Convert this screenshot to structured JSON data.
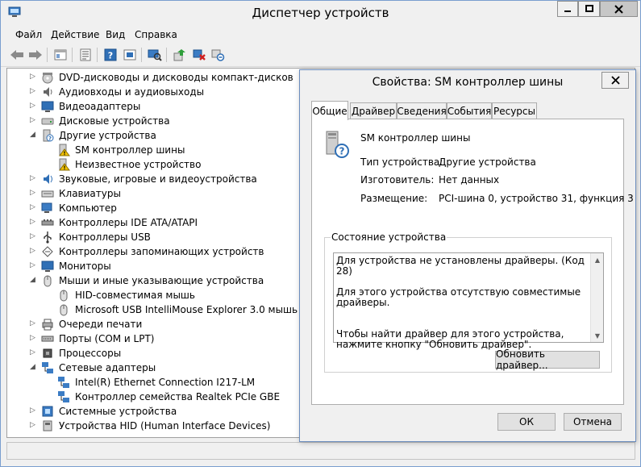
{
  "window": {
    "title": "Диспетчер устройств"
  },
  "menu": [
    "Файл",
    "Действие",
    "Вид",
    "Справка"
  ],
  "toolbar": {
    "buttons": [
      "back-icon",
      "forward-icon",
      "properties-pane-icon",
      "properties-icon",
      "help-icon",
      "refresh-view-icon",
      "scan-hardware-icon",
      "update-driver-icon",
      "uninstall-icon",
      "disable-icon"
    ]
  },
  "tree": {
    "items": [
      {
        "label": "DVD-дисководы и дисководы компакт-дисков",
        "level": 0,
        "expanded": false
      },
      {
        "label": "Аудиовходы и аудиовыходы",
        "level": 0,
        "expanded": false
      },
      {
        "label": "Видеоадаптеры",
        "level": 0,
        "expanded": false
      },
      {
        "label": "Дисковые устройства",
        "level": 0,
        "expanded": false
      },
      {
        "label": "Другие устройства",
        "level": 0,
        "expanded": true
      },
      {
        "label": "SM контроллер шины",
        "level": 1,
        "warning": true
      },
      {
        "label": "Неизвестное устройство",
        "level": 1,
        "warning": true
      },
      {
        "label": "Звуковые, игровые и видеоустройства",
        "level": 0,
        "expanded": false
      },
      {
        "label": "Клавиатуры",
        "level": 0,
        "expanded": false
      },
      {
        "label": "Компьютер",
        "level": 0,
        "expanded": false
      },
      {
        "label": "Контроллеры IDE ATA/ATAPI",
        "level": 0,
        "expanded": false
      },
      {
        "label": "Контроллеры USB",
        "level": 0,
        "expanded": false
      },
      {
        "label": "Контроллеры запоминающих устройств",
        "level": 0,
        "expanded": false
      },
      {
        "label": "Мониторы",
        "level": 0,
        "expanded": false
      },
      {
        "label": "Мыши и иные указывающие устройства",
        "level": 0,
        "expanded": true
      },
      {
        "label": "HID-совместимая мышь",
        "level": 1
      },
      {
        "label": "Microsoft USB IntelliMouse Explorer 3.0 мышь",
        "level": 1
      },
      {
        "label": "Очереди печати",
        "level": 0,
        "expanded": false
      },
      {
        "label": "Порты (COM и LPT)",
        "level": 0,
        "expanded": false
      },
      {
        "label": "Процессоры",
        "level": 0,
        "expanded": false
      },
      {
        "label": "Сетевые адаптеры",
        "level": 0,
        "expanded": true
      },
      {
        "label": "Intel(R) Ethernet Connection I217-LM",
        "level": 1
      },
      {
        "label": "Контроллер семейства Realtek PCIe GBE",
        "level": 1
      },
      {
        "label": "Системные устройства",
        "level": 0,
        "expanded": false
      },
      {
        "label": "Устройства HID (Human Interface Devices)",
        "level": 0,
        "expanded": false
      }
    ]
  },
  "dialog": {
    "title": "Свойства: SM контроллер шины",
    "tabs": [
      "Общие",
      "Драйвер",
      "Сведения",
      "События",
      "Ресурсы"
    ],
    "active_tab": "Общие",
    "device_name": "SM контроллер шины",
    "properties": [
      {
        "label": "Тип устройства:",
        "value": "Другие устройства"
      },
      {
        "label": "Изготовитель:",
        "value": "Нет данных"
      },
      {
        "label": "Размещение:",
        "value": "PCI-шина 0, устройство 31, функция 3"
      }
    ],
    "status_group_title": "Состояние устройства",
    "status_lines": [
      "Для устройства не установлены драйверы. (Код 28)",
      "Для этого устройства отсутствую совместимые драйверы.",
      "Чтобы найти драйвер для этого устройства, нажмите кнопку \"Обновить драйвер\"."
    ],
    "update_driver_label": "Обновить драйвер...",
    "ok_label": "ОК",
    "cancel_label": "Отмена"
  },
  "colors": {
    "window_bg": "#f0f0f0",
    "border": "#7a9ecf",
    "warning": "#f2c200",
    "icon_blue": "#2f6fb6"
  }
}
